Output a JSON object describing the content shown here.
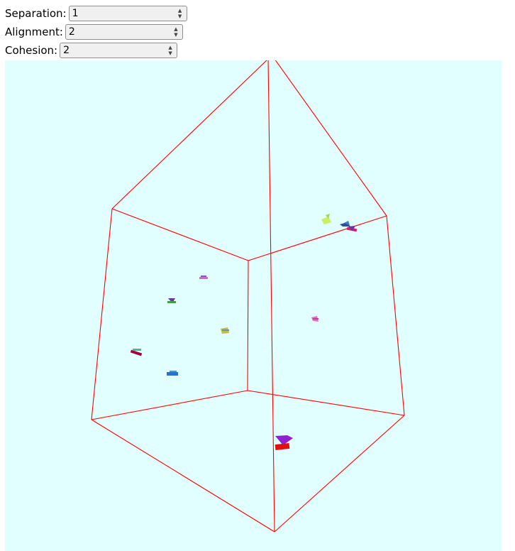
{
  "controls": {
    "separation": {
      "label": "Separation:",
      "value": "1"
    },
    "alignment": {
      "label": "Alignment:",
      "value": "2"
    },
    "cohesion": {
      "label": "Cohesion:",
      "value": "2"
    }
  },
  "scene": {
    "background": "#e1ffff",
    "edge_color": "#ff0000",
    "boids": [
      {
        "name": "boid-yellow-green",
        "color": "#c8f060"
      },
      {
        "name": "boid-blue-pair",
        "color": "#2a4fa0"
      },
      {
        "name": "boid-magenta-pair",
        "color": "#cc2266"
      },
      {
        "name": "boid-violet",
        "color": "#a040c0"
      },
      {
        "name": "boid-purple-green",
        "color": "#5a3aa0"
      },
      {
        "name": "boid-olive",
        "color": "#b8c040"
      },
      {
        "name": "boid-pink",
        "color": "#e070c0"
      },
      {
        "name": "boid-crimson",
        "color": "#a00040"
      },
      {
        "name": "boid-blue",
        "color": "#2a70d0"
      },
      {
        "name": "boid-red-large",
        "color": "#e01010"
      }
    ]
  }
}
